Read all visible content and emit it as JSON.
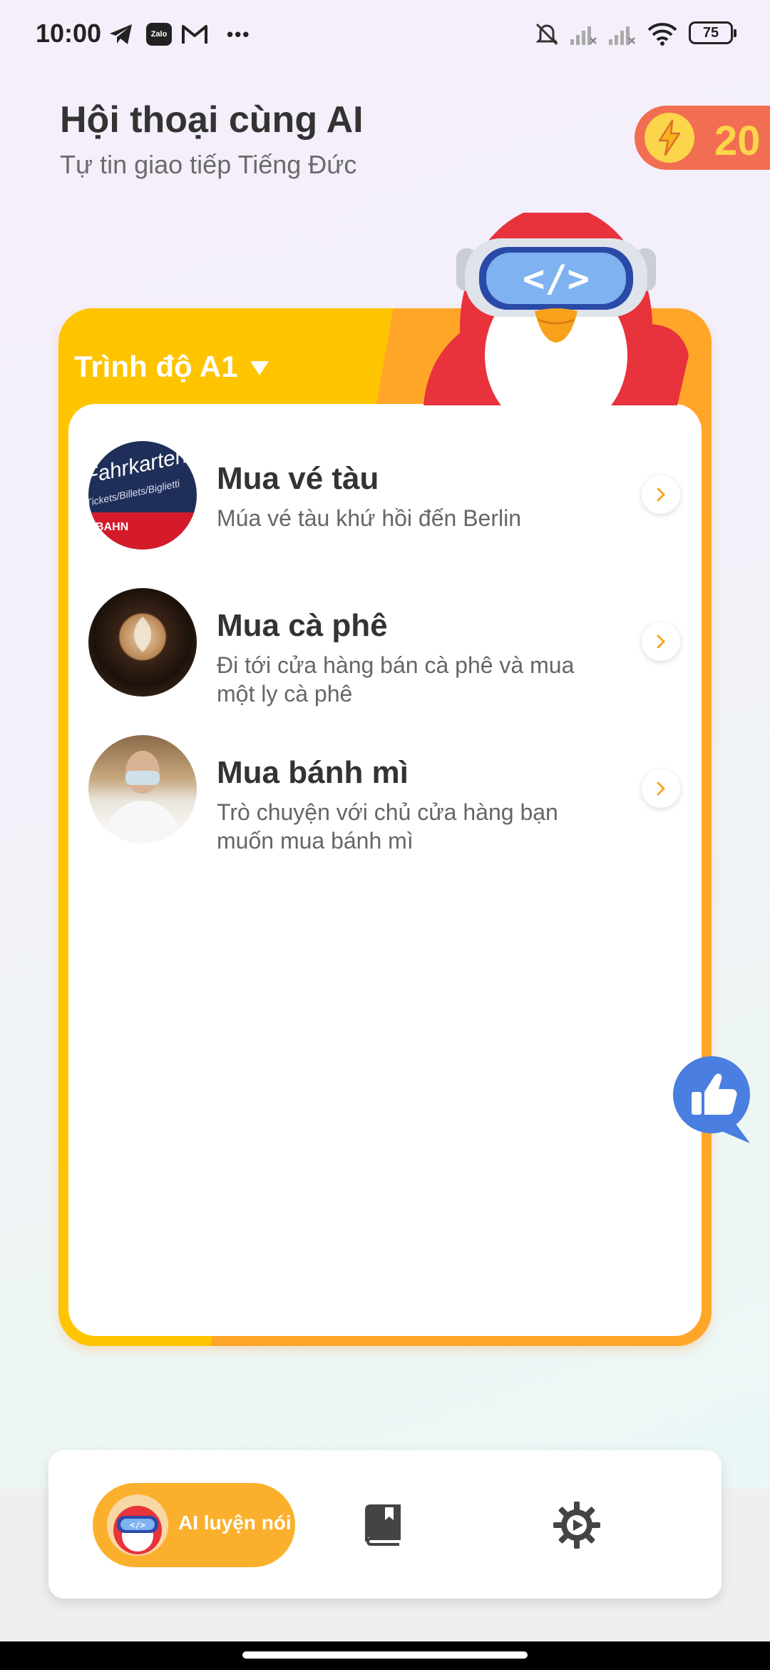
{
  "status_bar": {
    "time": "10:00",
    "zalo_label": "Zalo",
    "more": "•••",
    "battery": "75"
  },
  "header": {
    "title": "Hội thoại cùng AI",
    "subtitle": "Tự tin giao tiếp Tiếng Đức",
    "energy_count": "20",
    "energy_icon": "lightning-bolt-icon"
  },
  "level": {
    "label": "Trình độ A1"
  },
  "lessons": [
    {
      "title": "Mua vé tàu",
      "description": "Múa vé tàu khứ hồi đến Berlin",
      "sign_line1": "Fahrkarten",
      "sign_line2": "Tickets/Billets/Biglietti",
      "sign_brand": "BAHN"
    },
    {
      "title": "Mua cà phê",
      "description": "Đi tới cửa hàng bán cà phê và mua một ly cà phê"
    },
    {
      "title": "Mua bánh mì",
      "description": "Trò chuyện với chủ cửa hàng bạn muốn mua bánh mì"
    }
  ],
  "nav": {
    "active_label": "AI luyện nói",
    "items": [
      "ai-practice",
      "book-icon",
      "settings-gear-icon"
    ]
  },
  "colors": {
    "card_yellow": "#ffc400",
    "card_orange": "#ffa629",
    "energy_bg": "#f26e52",
    "like_button": "#4a7ee0"
  }
}
